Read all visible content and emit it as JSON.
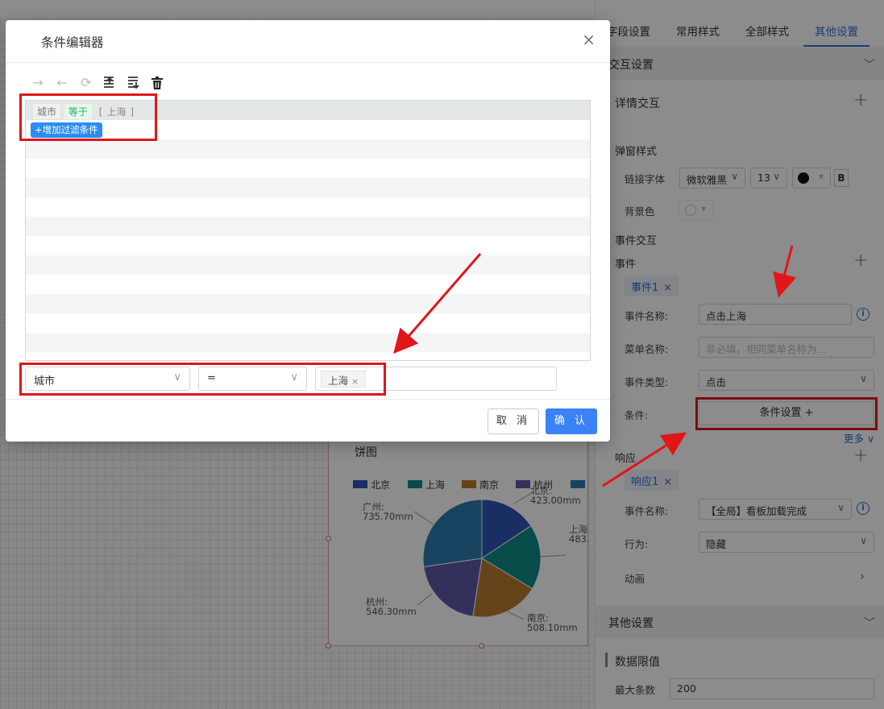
{
  "modal": {
    "title": "条件编辑器",
    "close": "×",
    "condition": {
      "field": "城市",
      "operator": "等于",
      "value_open": "[",
      "value": "上海",
      "value_close": "]"
    },
    "add_filter": "+增加过滤条件",
    "field_select": "城市",
    "operator_select": "=",
    "value_tag": "上海",
    "cancel": "取 消",
    "confirm": "确 认"
  },
  "right_panel": {
    "tabs": [
      "字段设置",
      "常用样式",
      "全部样式",
      "其他设置"
    ],
    "active_tab": "其他设置",
    "section_interaction": "交互设置",
    "detail_interaction": "详情交互",
    "popup_style": "弹窗样式",
    "link_font_label": "链接字体",
    "link_font_value": "微软雅黑",
    "font_size_value": "13",
    "bold": "B",
    "bg_color_label": "背景色",
    "event_interaction": "事件交互",
    "event_label": "事件",
    "event_tag": "事件1",
    "event_name_label": "事件名称:",
    "event_name_value": "点击上海",
    "menu_name_label": "菜单名称:",
    "menu_name_placeholder": "非必填，相同菜单名称为...",
    "event_type_label": "事件类型:",
    "event_type_value": "点击",
    "condition_label": "条件:",
    "condition_button": "条件设置 +",
    "more": "更多",
    "response_label": "响应",
    "response_tag": "响应1",
    "resp_event_name_label": "事件名称:",
    "resp_event_name_value": "【全局】看板加载完成",
    "behavior_label": "行为:",
    "behavior_value": "隐藏",
    "animation_label": "动画",
    "section_other": "其他设置",
    "data_limit": "数据限值",
    "max_rows_label": "最大条数",
    "max_rows_value": "200"
  },
  "pie_chart": {
    "title": "饼图",
    "legend": [
      "北京",
      "上海",
      "南京",
      "杭州",
      ""
    ],
    "labels": {
      "beijing_name": "北京:",
      "beijing_value": "423.00mm",
      "shanghai_name": "上海",
      "shanghai_value": "483.",
      "nanjing_name": "南京:",
      "nanjing_value": "508.10mm",
      "hangzhou_name": "杭州:",
      "hangzhou_value": "546.30mm",
      "guangzhou_name": "广州:",
      "guangzhou_value": "735.70mm"
    }
  },
  "chart_data": {
    "type": "pie",
    "title": "饼图",
    "categories": [
      "北京",
      "上海",
      "南京",
      "杭州",
      "广州"
    ],
    "values": [
      423.0,
      483.0,
      508.1,
      546.3,
      735.7
    ],
    "colors": [
      "#2f54b3",
      "#0d8a84",
      "#b97a30",
      "#5d59a6",
      "#2a7bb0"
    ]
  }
}
